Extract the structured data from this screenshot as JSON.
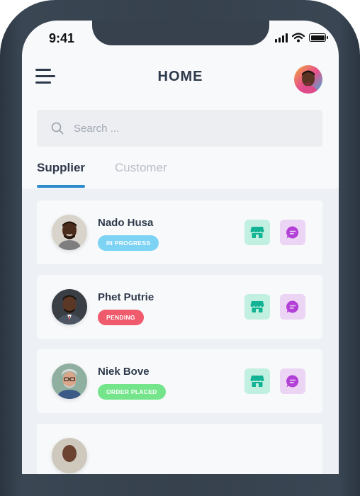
{
  "status_bar": {
    "time": "9:41"
  },
  "header": {
    "title": "HOME"
  },
  "search": {
    "placeholder": "Search ..."
  },
  "tabs": [
    {
      "label": "Supplier",
      "active": true
    },
    {
      "label": "Customer",
      "active": false
    }
  ],
  "suppliers": [
    {
      "name": "Nado Husa",
      "status": "IN PROGRESS",
      "status_color": "#7dd3f3"
    },
    {
      "name": "Phet Putrie",
      "status": "PENDING",
      "status_color": "#ef5a6c"
    },
    {
      "name": "Niek Bove",
      "status": "ORDER PLACED",
      "status_color": "#74e58b"
    }
  ],
  "colors": {
    "accent": "#2e8bce",
    "store_action": "#12b394",
    "chat_action": "#b23fd6"
  },
  "icons": [
    "menu-icon",
    "search-icon",
    "store-icon",
    "chat-icon"
  ]
}
